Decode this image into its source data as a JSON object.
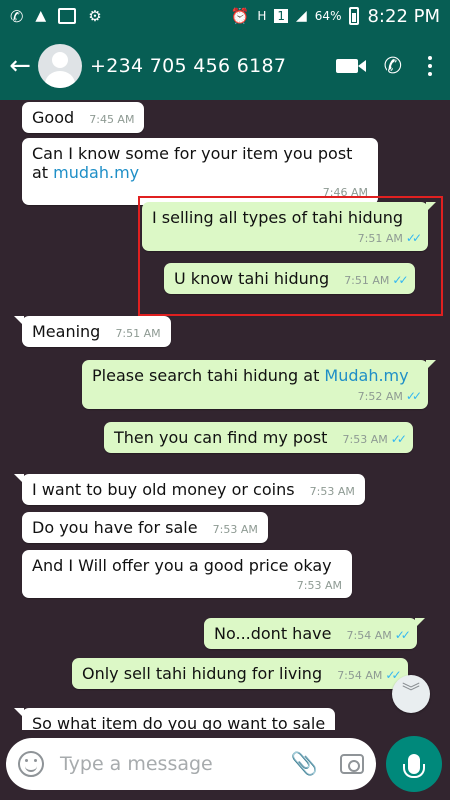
{
  "status": {
    "battery": "64%",
    "time": "8:22 PM",
    "sim": "1",
    "network": "H"
  },
  "header": {
    "contact": "+234 705 456 6187"
  },
  "messages": [
    {
      "text": "Good",
      "time": "7:45 AM"
    },
    {
      "text_before": "Can I know some for your item you post at ",
      "link": "mudah.my",
      "time": "7:46 AM"
    },
    {
      "text": "I selling all types of tahi hidung",
      "time": "7:51 AM"
    },
    {
      "text": "U know tahi hidung",
      "time": "7:51 AM"
    },
    {
      "text": "Meaning",
      "time": "7:51 AM"
    },
    {
      "text_before": "Please search tahi hidung at ",
      "link": "Mudah.my",
      "time": "7:52 AM"
    },
    {
      "text": "Then you can find my post",
      "time": "7:53 AM"
    },
    {
      "text": "I want to buy old money or coins",
      "time": "7:53 AM"
    },
    {
      "text": "Do you have for sale",
      "time": "7:53 AM"
    },
    {
      "text": "And I Will offer you a good price okay",
      "time": "7:53 AM"
    },
    {
      "text": "No...dont have",
      "time": "7:54 AM"
    },
    {
      "text": "Only sell tahi hidung for living",
      "time": "7:54 AM"
    },
    {
      "text": "So what item do you go want to sale"
    }
  ],
  "input": {
    "placeholder": "Type a message"
  }
}
